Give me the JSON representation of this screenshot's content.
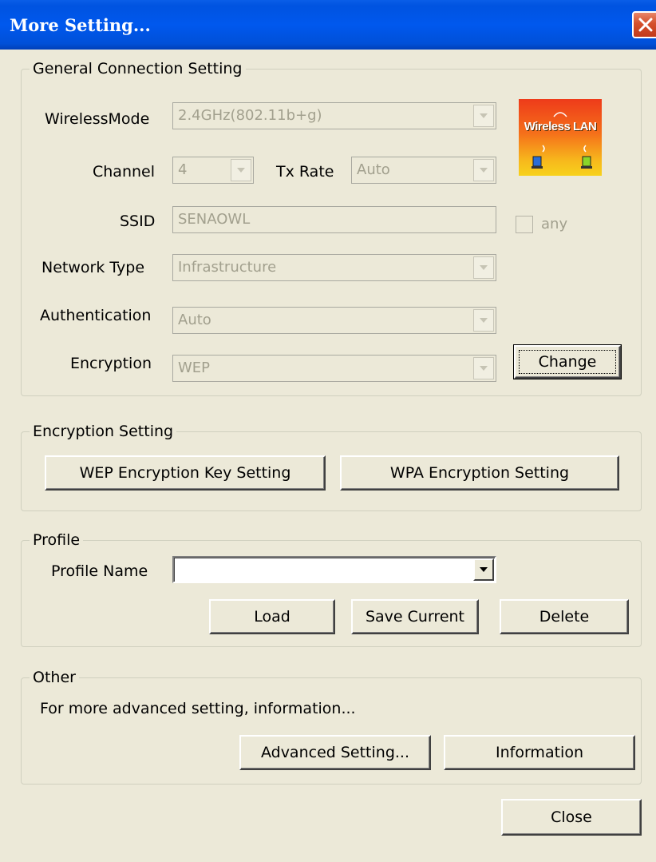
{
  "window": {
    "title": "More Setting...",
    "close_icon": "close-icon"
  },
  "general": {
    "legend": "General Connection Setting",
    "wireless_mode": {
      "label": "WirelessMode",
      "value": "2.4GHz(802.11b+g)"
    },
    "channel": {
      "label": "Channel",
      "value": "4"
    },
    "tx_rate": {
      "label": "Tx Rate",
      "value": "Auto"
    },
    "ssid": {
      "label": "SSID",
      "value": "SENAOWL"
    },
    "any": {
      "label": "any",
      "checked": false
    },
    "network_type": {
      "label": "Network Type",
      "value": "Infrastructure"
    },
    "authentication": {
      "label": "Authentication",
      "value": "Auto"
    },
    "encryption": {
      "label": "Encryption",
      "value": "WEP"
    },
    "change_button": "Change",
    "logo_text": "Wireless LAN"
  },
  "encryption_setting": {
    "legend": "Encryption Setting",
    "wep_button": "WEP Encryption Key Setting",
    "wpa_button": "WPA Encryption Setting"
  },
  "profile": {
    "legend": "Profile",
    "name_label": "Profile Name",
    "name_value": "",
    "load_button": "Load",
    "save_button": "Save Current",
    "delete_button": "Delete"
  },
  "other": {
    "legend": "Other",
    "description": "For more advanced setting, information...",
    "advanced_button": "Advanced Setting...",
    "information_button": "Information"
  },
  "footer": {
    "close_button": "Close"
  },
  "colors": {
    "titlebar": "#0054e3",
    "dialog_bg": "#ece9d8",
    "disabled_text": "#a2a08e",
    "close_red": "#d4502c"
  }
}
